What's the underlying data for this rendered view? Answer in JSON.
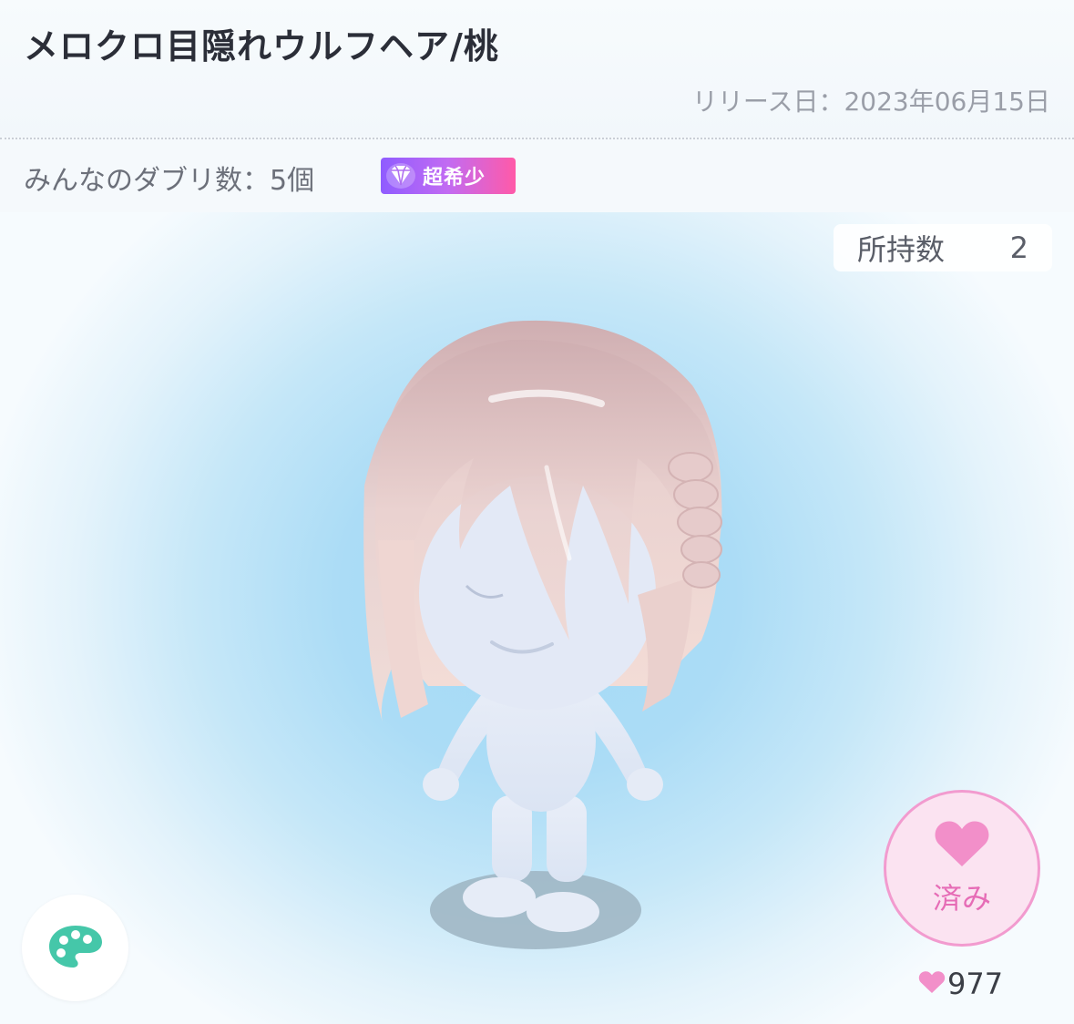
{
  "header": {
    "title": "メロクロ目隠れウルフヘア/桃",
    "release_date": "リリース日：2023年06月15日"
  },
  "duplicates": {
    "label": "みんなのダブリ数：5個",
    "rarity_badge": "超希少",
    "badge_icon": "diamond-icon"
  },
  "owned": {
    "label": "所持数",
    "count": "2"
  },
  "like": {
    "status_label": "済み",
    "count": "977",
    "color": "#f28fc9"
  },
  "palette": {
    "icon": "palette-icon",
    "color": "#45c7a9"
  }
}
